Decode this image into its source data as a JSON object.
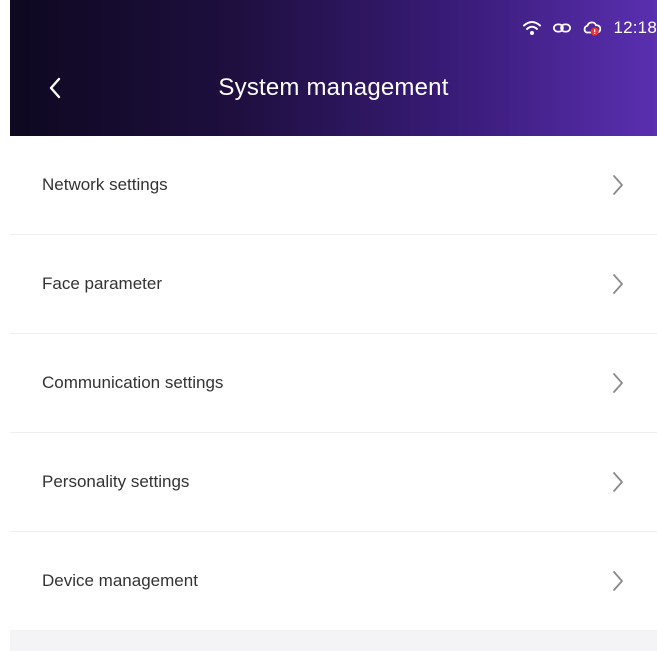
{
  "status_bar": {
    "time": "12:18",
    "icons": [
      "wifi-icon",
      "link-icon",
      "cloud-alert-icon"
    ]
  },
  "header": {
    "title": "System management",
    "back_icon": "chevron-left-icon"
  },
  "menu": {
    "items": [
      {
        "label": "Network settings"
      },
      {
        "label": "Face parameter"
      },
      {
        "label": "Communication settings"
      },
      {
        "label": "Personality settings"
      },
      {
        "label": "Device management"
      }
    ],
    "chevron_icon": "chevron-right-icon"
  },
  "colors": {
    "header_start": "#0e0820",
    "header_end": "#5a2fb0",
    "text": "#333333",
    "chevron": "#8a8a8a",
    "divider": "#eeeeee",
    "alert": "#e53935"
  }
}
